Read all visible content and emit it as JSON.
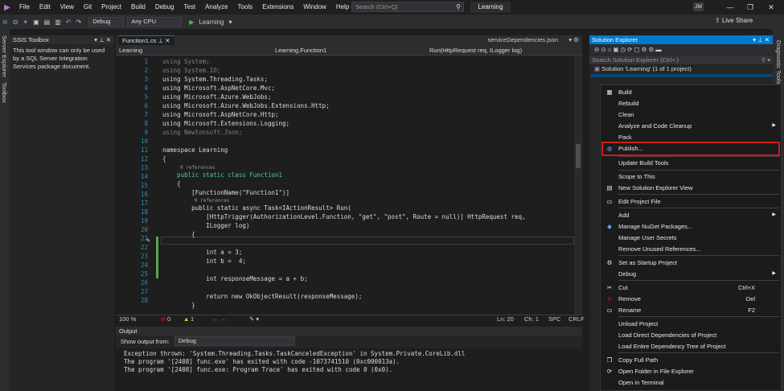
{
  "menubar": {
    "items": [
      "File",
      "Edit",
      "View",
      "Git",
      "Project",
      "Build",
      "Debug",
      "Test",
      "Analyze",
      "Tools",
      "Extensions",
      "Window",
      "Help"
    ],
    "search_placeholder": "Search (Ctrl+Q)",
    "solution_title": "Learning",
    "avatar": "JM"
  },
  "toolbar": {
    "config": "Debug",
    "platform": "Any CPU",
    "run_target": "Learning",
    "liveshare": "Live Share"
  },
  "left_tabs": [
    "Server Explorer",
    "Toolbox"
  ],
  "right_tabs": [
    "Diagnostic Tools"
  ],
  "ssis": {
    "title": "SSIS Toolbox",
    "message": "This tool window can only be used by a SQL Server Integration Services package document."
  },
  "editor": {
    "tab": "Function1.cs",
    "other_tab": "serviceDependencies.json",
    "nav_project": "Learning",
    "nav_class": "Learning.Function1",
    "nav_member": "Run(HttpRequest req, ILogger log)",
    "line_numbers": [
      "1",
      "2",
      "3",
      "4",
      "5",
      "6",
      "7",
      "8",
      "9",
      "10",
      "11",
      "12",
      "13",
      "14",
      "15",
      "16",
      "17",
      "18",
      "19",
      "20",
      "21",
      "22",
      "23",
      "24",
      "25",
      "26",
      "27",
      "28"
    ],
    "lines": {
      "l1": "using System;",
      "l2": "using System.IO;",
      "l3": "using System.Threading.Tasks;",
      "l4": "using Microsoft.AspNetCore.Mvc;",
      "l5": "using Microsoft.Azure.WebJobs;",
      "l6": "using Microsoft.Azure.WebJobs.Extensions.Http;",
      "l7": "using Microsoft.AspNetCore.Http;",
      "l8": "using Microsoft.Extensions.Logging;",
      "l9": "using Newtonsoft.Json;",
      "l11": "namespace Learning",
      "l12": "{",
      "l13": "    public static class Function1",
      "l14": "    {",
      "l15": "        [FunctionName(\"Function1\")]",
      "l16": "        public static async Task<IActionResult> Run(",
      "l17": "            [HttpTrigger(AuthorizationLevel.Function, \"get\", \"post\", Route = null)] HttpRequest req,",
      "l18": "            ILogger log)",
      "l19": "        {",
      "l21": "            int a = 3;",
      "l22": "            int b =  4;",
      "l24": "            int responseMessage = a + b;",
      "l26": "            return new OkObjectResult(responseMessage);",
      "l27": "        }"
    },
    "refs": "0 references"
  },
  "status": {
    "zoom": "100 %",
    "errors": "0",
    "warnings": "1",
    "ln": "Ln: 20",
    "ch": "Ch: 1",
    "spc": "SPC",
    "crlf": "CRLF"
  },
  "output": {
    "title": "Output",
    "show_from_label": "Show output from:",
    "show_from_value": "Debug",
    "lines": [
      "Exception thrown: 'System.Threading.Tasks.TaskCanceledException' in System.Private.CoreLib.dll",
      "The program '[2408] func.exe' has exited with code -1073741510 (0xc000013a).",
      "The program '[2408] func.exe: Program Trace' has exited with code 0 (0x0)."
    ]
  },
  "solution_explorer": {
    "title": "Solution Explorer",
    "search_placeholder": "Search Solution Explorer (Ctrl+;)",
    "solution_node": "Solution 'Learning' (1 of 1 project)"
  },
  "context_menu": {
    "build": "Build",
    "rebuild": "Rebuild",
    "clean": "Clean",
    "analyze": "Analyze and Code Cleanup",
    "pack": "Pack",
    "publish": "Publish...",
    "update_tools": "Update Build Tools",
    "scope": "Scope to This",
    "new_view": "New Solution Explorer View",
    "edit_project": "Edit Project File",
    "add": "Add",
    "nuget": "Manage NuGet Packages...",
    "secrets": "Manage User Secrets",
    "remove_refs": "Remove Unused References...",
    "startup": "Set as Startup Project",
    "debug": "Debug",
    "cut": "Cut",
    "cut_sc": "Ctrl+X",
    "remove": "Remove",
    "remove_sc": "Del",
    "rename": "Rename",
    "rename_sc": "F2",
    "unload": "Unload Project",
    "load_direct": "Load Direct Dependencies of Project",
    "load_tree": "Load Entire Dependency Tree of Project",
    "copy_path": "Copy Full Path",
    "open_folder": "Open Folder in File Explorer",
    "open_terminal": "Open in Terminal"
  }
}
